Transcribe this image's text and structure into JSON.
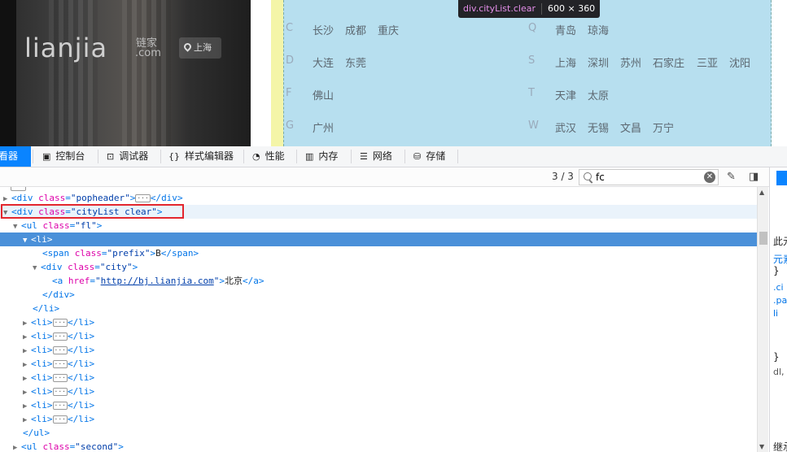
{
  "preview": {
    "logo_text": "lianjia",
    "logo_cn": "链家",
    "logo_com": ".com",
    "location": "上海",
    "tooltip_tag": "div.cityList.clear",
    "tooltip_size": "600 × 360",
    "left_groups": [
      {
        "prefix": "C",
        "cities": [
          "长沙",
          "成都",
          "重庆"
        ]
      },
      {
        "prefix": "D",
        "cities": [
          "大连",
          "东莞"
        ]
      },
      {
        "prefix": "F",
        "cities": [
          "佛山"
        ]
      },
      {
        "prefix": "G",
        "cities": [
          "广州"
        ]
      }
    ],
    "right_groups": [
      {
        "prefix": "Q",
        "cities": [
          "青岛",
          "琼海"
        ]
      },
      {
        "prefix": "S",
        "cities": [
          "上海",
          "深圳",
          "苏州",
          "石家庄",
          "三亚",
          "沈阳"
        ]
      },
      {
        "prefix": "T",
        "cities": [
          "天津",
          "太原"
        ]
      },
      {
        "prefix": "W",
        "cities": [
          "武汉",
          "无锡",
          "文昌",
          "万宁"
        ]
      }
    ]
  },
  "devtools": {
    "tabs": [
      "查看器",
      "控制台",
      "调试器",
      "样式编辑器",
      "性能",
      "内存",
      "网络",
      "存储"
    ],
    "search_count": "3 / 3",
    "search_value": "fc",
    "clear_symbol": "✕",
    "side_items": [
      "此元",
      "元素",
      "}",
      ".ci",
      ".pa",
      "li",
      "}",
      "dl,",
      "继承"
    ]
  },
  "tree": {
    "popheader": {
      "tag": "div",
      "attr": "class",
      "value": "popheader"
    },
    "citylist": {
      "tag": "div",
      "attr": "class",
      "value": "cityList clear"
    },
    "ul_fl": {
      "tag": "ul",
      "attr": "class",
      "value": "fl"
    },
    "li": "li",
    "span_prefix": {
      "attr": "class",
      "value": "prefix",
      "text": "B"
    },
    "div_city": {
      "attr": "class",
      "value": "city"
    },
    "link": {
      "attr": "href",
      "value": "http://bj.lianjia.com",
      "text": "北京"
    },
    "ul_second": {
      "tag": "ul",
      "attr": "class",
      "value": "second"
    },
    "collapsed_li_count": 8
  }
}
